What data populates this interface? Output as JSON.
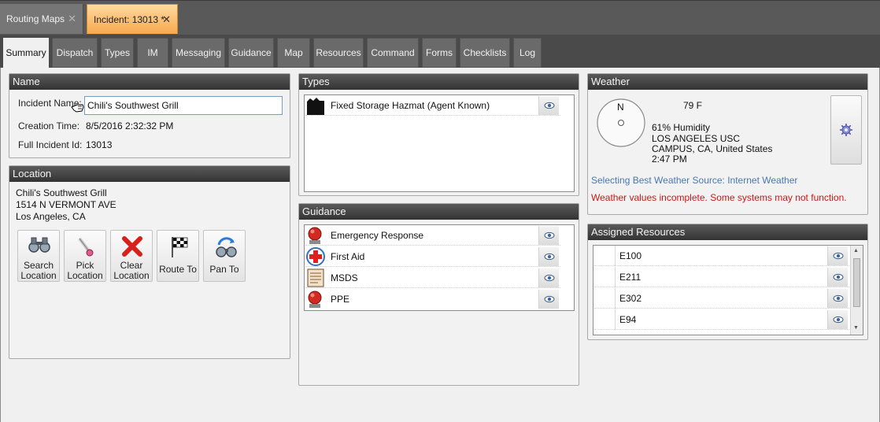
{
  "doc_tabs": [
    {
      "label": "Routing Maps",
      "close": "✕"
    },
    {
      "label": "Incident: 13013 *",
      "close": "✕"
    }
  ],
  "sub_tabs": [
    "Summary",
    "Dispatch",
    "Types",
    "IM",
    "Messaging",
    "Guidance",
    "Map",
    "Resources",
    "Command",
    "Forms",
    "Checklists",
    "Log"
  ],
  "name_panel": {
    "title": "Name",
    "incident_name_label": "Incident Name:",
    "incident_name_value": "Chili's Southwest Grill",
    "creation_time_label": "Creation Time:",
    "creation_time_value": "8/5/2016 2:32:32 PM",
    "full_id_label": "Full Incident Id:",
    "full_id_value": "13013"
  },
  "location_panel": {
    "title": "Location",
    "address": [
      "Chili's Southwest Grill",
      "1514 N VERMONT AVE",
      "Los Angeles, CA"
    ],
    "buttons": [
      {
        "line1": "Search",
        "line2": "Location",
        "icon": "binoculars-icon"
      },
      {
        "line1": "Pick",
        "line2": "Location",
        "icon": "pick-pointer-icon"
      },
      {
        "line1": "Clear",
        "line2": "Location",
        "icon": "red-x-icon"
      },
      {
        "line1": "Route To",
        "line2": "",
        "icon": "checkered-flag-icon"
      },
      {
        "line1": "Pan To",
        "line2": "",
        "icon": "pan-binoculars-icon"
      }
    ]
  },
  "types_panel": {
    "title": "Types",
    "items": [
      {
        "label": "Fixed Storage Hazmat (Agent Known)",
        "icon": "building-icon"
      }
    ]
  },
  "guidance_panel": {
    "title": "Guidance",
    "items": [
      {
        "label": "Emergency Response",
        "icon": "alarm-bell-icon"
      },
      {
        "label": "First Aid",
        "icon": "red-cross-icon"
      },
      {
        "label": "MSDS",
        "icon": "document-icon"
      },
      {
        "label": "PPE",
        "icon": "alarm-bell-icon"
      }
    ]
  },
  "weather_panel": {
    "title": "Weather",
    "compass_letter": "N",
    "temperature": "79 F",
    "humidity": "61% Humidity",
    "station_line1": "LOS ANGELES USC",
    "station_line2": "CAMPUS, CA, United States",
    "time": "2:47 PM",
    "source_text": "Selecting Best Weather Source: Internet Weather",
    "warning_text": "Weather values incomplete. Some systems may not function."
  },
  "resources_panel": {
    "title": "Assigned Resources",
    "items": [
      "E100",
      "E211",
      "E302",
      "E94"
    ]
  },
  "colors": {
    "active_tab": "#f7a94d",
    "link_blue": "#4a78b0",
    "warning_red": "#d01515"
  }
}
